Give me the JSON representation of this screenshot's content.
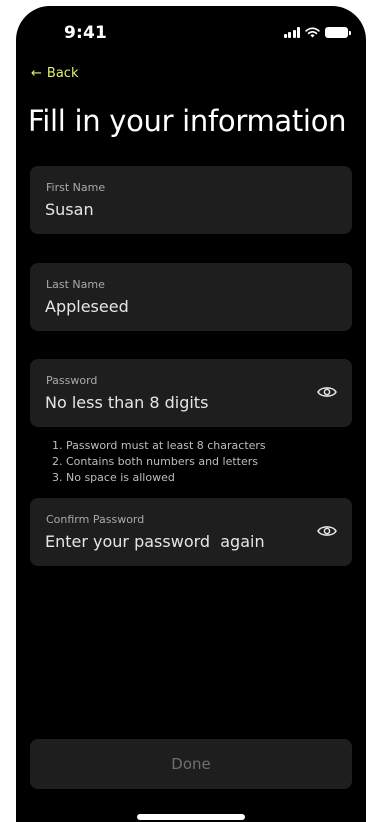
{
  "status_bar": {
    "time": "9:41"
  },
  "nav": {
    "back_label": "Back",
    "back_icon": "arrow-left-icon"
  },
  "page": {
    "title": "Fill in your information"
  },
  "form": {
    "first_name": {
      "label": "First Name",
      "value": "Susan"
    },
    "last_name": {
      "label": "Last Name",
      "value": "Appleseed"
    },
    "password": {
      "label": "Password",
      "placeholder": "No less than 8 digits",
      "icon": "eye-icon"
    },
    "password_rules": [
      "1. Password must at least 8 characters",
      "2. Contains both numbers and letters",
      "3. No space is allowed"
    ],
    "confirm_password": {
      "label": "Confirm Password",
      "placeholder": "Enter your password  again",
      "icon": "eye-icon"
    }
  },
  "actions": {
    "done_label": "Done"
  },
  "colors": {
    "background": "#000000",
    "field_background": "#1e1e1e",
    "accent": "#e3ef6b",
    "disabled_text": "#6f6f6f"
  }
}
